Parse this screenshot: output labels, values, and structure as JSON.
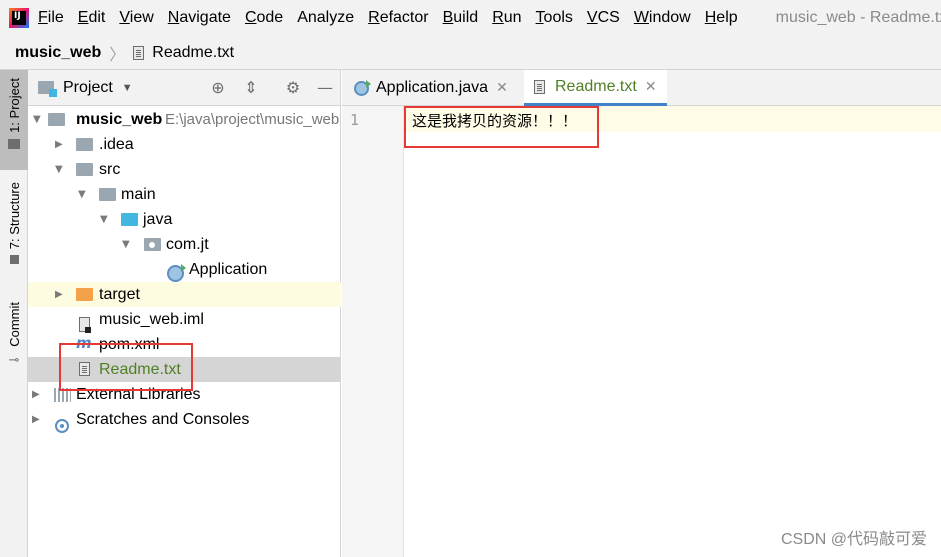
{
  "menubar": {
    "items": [
      {
        "mnemonic": "F",
        "rest": "ile"
      },
      {
        "mnemonic": "E",
        "rest": "dit"
      },
      {
        "mnemonic": "V",
        "rest": "iew"
      },
      {
        "mnemonic": "N",
        "rest": "avigate"
      },
      {
        "mnemonic": "C",
        "rest": "ode"
      },
      {
        "mnemonic": "",
        "rest": "Analyze"
      },
      {
        "mnemonic": "R",
        "rest": "efactor"
      },
      {
        "mnemonic": "B",
        "rest": "uild"
      },
      {
        "mnemonic": "R",
        "rest": "un"
      },
      {
        "mnemonic": "T",
        "rest": "ools"
      },
      {
        "mnemonic": "V",
        "rest": "CS"
      },
      {
        "mnemonic": "W",
        "rest": "indow"
      },
      {
        "mnemonic": "H",
        "rest": "elp"
      }
    ],
    "window_title": "music_web - Readme.txt"
  },
  "navbar": {
    "project": "music_web",
    "file": "Readme.txt"
  },
  "left_strip": {
    "project_tab": "1: Project",
    "structure_tab": "7: Structure",
    "commit_tab": "Commit"
  },
  "project_panel": {
    "title": "Project",
    "tree": [
      {
        "label": "music_web",
        "path": "E:\\java\\project\\music_web"
      },
      {
        "label": ".idea"
      },
      {
        "label": "src"
      },
      {
        "label": "main"
      },
      {
        "label": "java"
      },
      {
        "label": "com.jt"
      },
      {
        "label": "Application"
      },
      {
        "label": "target"
      },
      {
        "label": "music_web.iml"
      },
      {
        "label": "pom.xml"
      },
      {
        "label": "Readme.txt"
      },
      {
        "label": "External Libraries"
      },
      {
        "label": "Scratches and Consoles"
      }
    ]
  },
  "editor": {
    "tabs": [
      {
        "label": "Application.java"
      },
      {
        "label": "Readme.txt"
      }
    ],
    "line_number": "1",
    "line_text": "这是我拷贝的资源！！！"
  },
  "watermark": "CSDN @代码敲可爱",
  "colors": {
    "highlight_box": "#e53935",
    "active_tab_underline": "#4083c9",
    "selected_row": "#d5d5d5",
    "target_row": "#fdfce1"
  }
}
